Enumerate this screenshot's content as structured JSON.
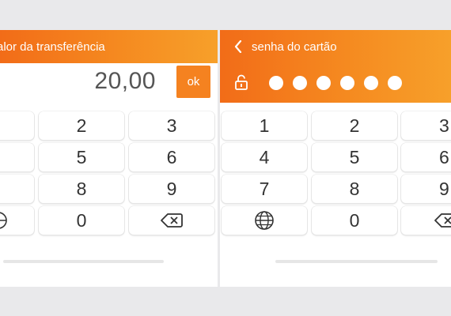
{
  "left_screen": {
    "title": "alor da transferência",
    "amount": "20,00",
    "ok_label": "ok",
    "keys": [
      "2",
      "3",
      "5",
      "6",
      "8",
      "9",
      "0"
    ]
  },
  "right_screen": {
    "title": "senha do cartão",
    "pin_dots": 6,
    "keys": [
      "1",
      "2",
      "3",
      "4",
      "5",
      "6",
      "7",
      "8",
      "9",
      "0"
    ]
  },
  "icons": {
    "back": "chevron-left-icon",
    "lock": "lock-icon",
    "globe": "globe-icon",
    "backspace": "backspace-icon"
  },
  "colors": {
    "brand_orange": "#f58220",
    "background": "#e9e9eb"
  }
}
